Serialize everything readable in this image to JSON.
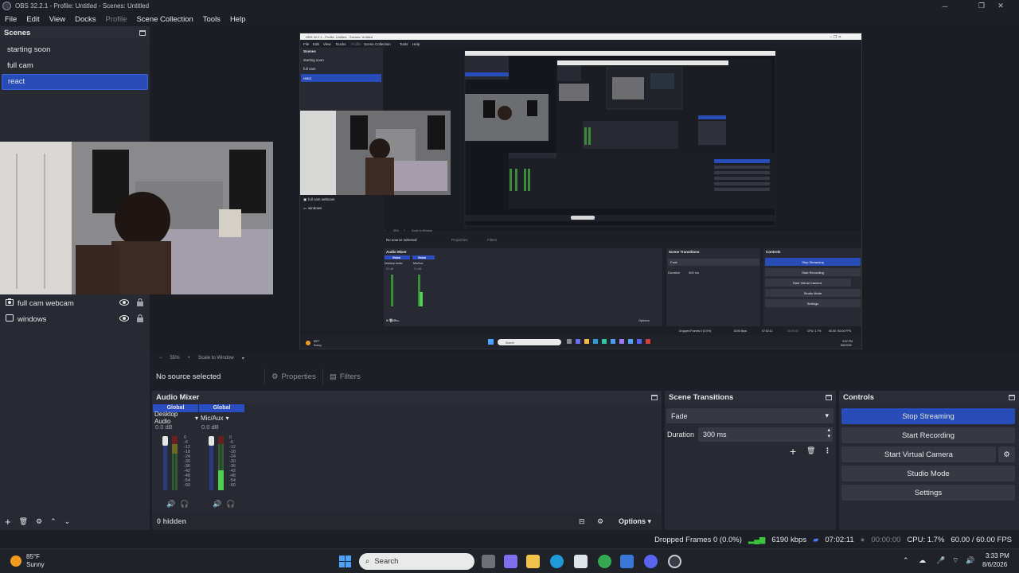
{
  "window": {
    "title": "OBS 32.2.1 - Profile: Untitled - Scenes: Untitled"
  },
  "menu": [
    "File",
    "Edit",
    "View",
    "Docks",
    "Profile",
    "Scene Collection",
    "Tools",
    "Help"
  ],
  "scenes": {
    "title": "Scenes",
    "items": [
      {
        "label": "starting soon",
        "selected": false
      },
      {
        "label": "full cam",
        "selected": false
      },
      {
        "label": "react",
        "selected": true
      }
    ]
  },
  "sources": {
    "items": [
      {
        "label": "full cam webcam",
        "icon": "camera-icon"
      },
      {
        "label": "windows",
        "icon": "window-icon"
      }
    ]
  },
  "preview": {
    "zoom": "55%",
    "scale_label": "Scale to Window"
  },
  "properties_bar": {
    "no_source": "No source selected",
    "properties_label": "Properties",
    "filters_label": "Filters"
  },
  "mixer": {
    "title": "Audio Mixer",
    "channels": [
      {
        "global": "Global",
        "name": "Desktop Audio",
        "db": "0.0 dB"
      },
      {
        "global": "Global",
        "name": "Mic/Aux",
        "db": "0.0 dB"
      }
    ],
    "scale": [
      "0",
      "-6",
      "-12",
      "-18",
      "-24",
      "-30",
      "-36",
      "-42",
      "-48",
      "-54",
      "-60"
    ],
    "hidden": "0 hidden",
    "options": "Options"
  },
  "transitions": {
    "title": "Scene Transitions",
    "selected": "Fade",
    "duration_label": "Duration",
    "duration_value": "300 ms"
  },
  "controls": {
    "title": "Controls",
    "stop_streaming": "Stop Streaming",
    "start_recording": "Start Recording",
    "start_virtual_camera": "Start Virtual Camera",
    "studio_mode": "Studio Mode",
    "settings": "Settings"
  },
  "status": {
    "dropped_frames": "Dropped Frames 0 (0.0%)",
    "bitrate": "6190 kbps",
    "stream_time": "07:02:11",
    "record_time": "00:00:00",
    "cpu": "CPU: 1.7%",
    "fps": "60.00 / 60.00 FPS"
  },
  "taskbar": {
    "weather_temp": "85°F",
    "weather_desc": "Sunny",
    "search_placeholder": "Search",
    "time": "3:33 PM",
    "date": "8/6/2026"
  },
  "nested_preview": {
    "title": "OBS 32.2.1 - Profile: Untitled - Scenes: Untitled",
    "menu": [
      "File",
      "Edit",
      "View",
      "Docks",
      "Profile",
      "Scene Collection",
      "Tools",
      "Help"
    ],
    "scenes_title": "Scenes",
    "scenes": [
      "starting soon",
      "full cam",
      "react"
    ],
    "sources": [
      "full cam webcam",
      "windows"
    ],
    "zoom": "55%",
    "scale_label": "Scale to Window",
    "no_source": "No source selected",
    "properties_label": "Properties",
    "filters_label": "Filters",
    "mixer_title": "Audio Mixer",
    "global_label": "Global",
    "channel_names": [
      "Desktop Audio",
      "Mic/Aux"
    ],
    "db": "0.0 dB",
    "hidden": "0 hidden",
    "options": "Options",
    "transitions_title": "Scene Transitions",
    "transition_selected": "Fade",
    "duration_label": "Duration",
    "duration_value": "300 ms",
    "controls_title": "Controls",
    "controls_buttons": [
      "Stop Streaming",
      "Start Recording",
      "Start Virtual Camera",
      "Studio Mode",
      "Settings"
    ],
    "dropped_frames": "Dropped Frames 0 (0.0%)",
    "bitrate": "6190 kbps",
    "stream_time": "07:02:11",
    "record_time": "00:00:00",
    "cpu": "CPU: 1.7%",
    "fps": "60.00 / 60.00 FPS",
    "weather_temp": "85°F",
    "weather_desc": "Sunny",
    "search": "Search",
    "time": "3:32 PM",
    "date": "8/6/2026"
  },
  "colors": {
    "accent": "#284cb8",
    "panel": "#272a33",
    "background": "#1d1f26"
  }
}
